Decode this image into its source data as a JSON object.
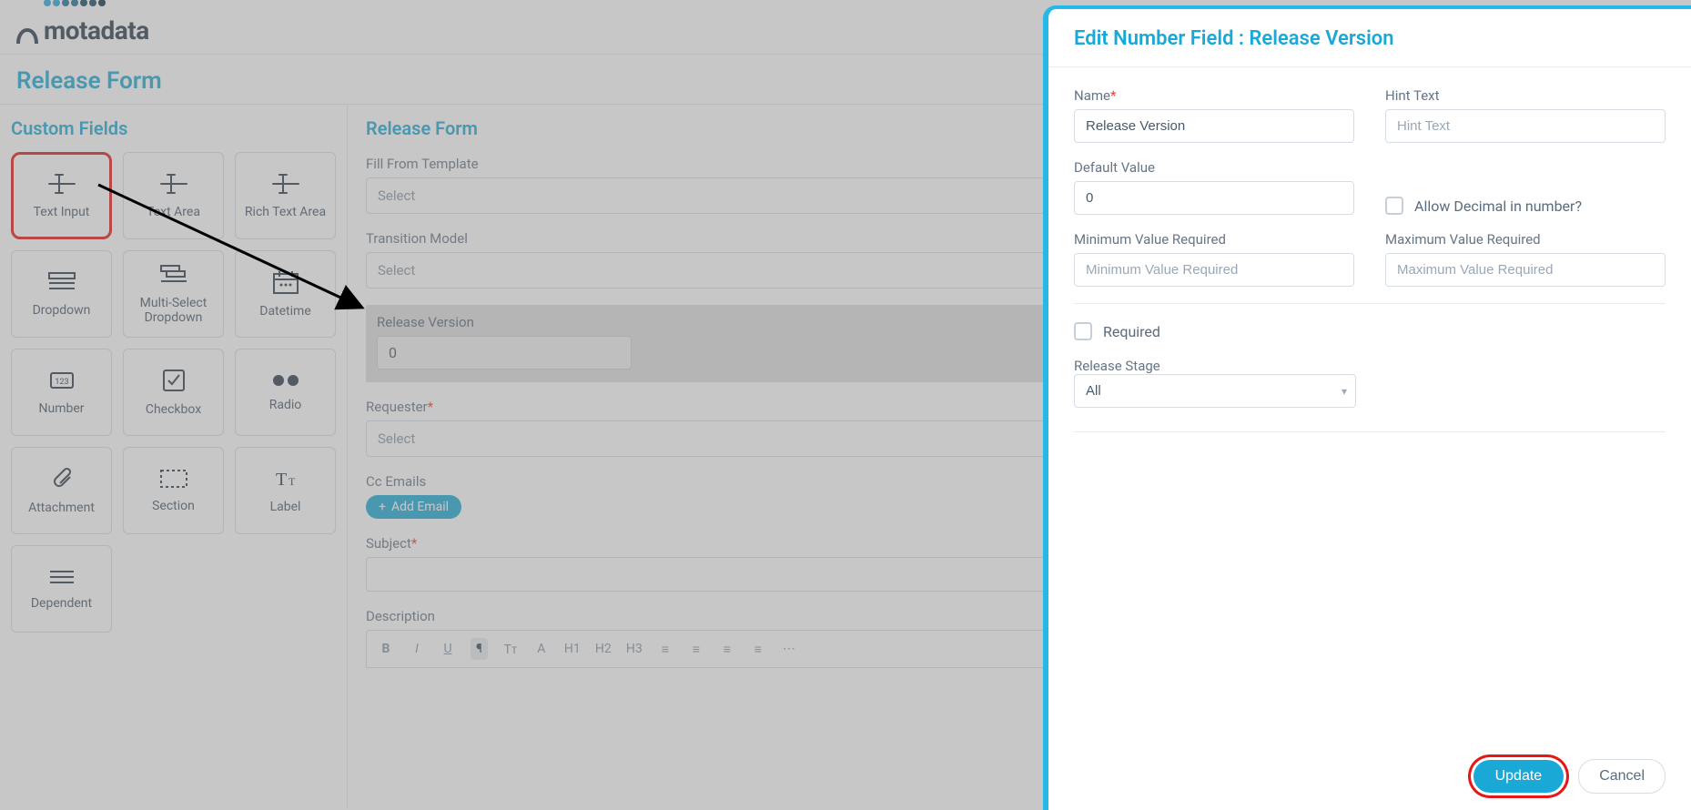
{
  "logo_text": "motadata",
  "page_title": "Release Form",
  "custom_fields": {
    "heading": "Custom Fields",
    "items": [
      {
        "label": "Text Input"
      },
      {
        "label": "Text Area"
      },
      {
        "label": "Rich Text Area"
      },
      {
        "label": "Dropdown"
      },
      {
        "label": "Multi-Select Dropdown"
      },
      {
        "label": "Datetime"
      },
      {
        "label": "Number"
      },
      {
        "label": "Checkbox"
      },
      {
        "label": "Radio"
      },
      {
        "label": "Attachment"
      },
      {
        "label": "Section"
      },
      {
        "label": "Label"
      },
      {
        "label": "Dependent"
      }
    ]
  },
  "form": {
    "heading": "Release Form",
    "fill_from_template": {
      "label": "Fill From Template",
      "placeholder": "Select"
    },
    "transition_model": {
      "label": "Transition Model",
      "placeholder": "Select"
    },
    "release_version": {
      "label": "Release Version",
      "value": "0"
    },
    "requester": {
      "label": "Requester",
      "placeholder": "Select"
    },
    "cc_emails": {
      "label": "Cc Emails",
      "add_label": "Add Email"
    },
    "subject": {
      "label": "Subject"
    },
    "description": {
      "label": "Description"
    },
    "rte_buttons": [
      "B",
      "I",
      "U",
      "¶",
      "Tᴛ",
      "A",
      "H1",
      "H2",
      "H3",
      "≡",
      "≡",
      "≡",
      "≡",
      "⋯"
    ]
  },
  "modal": {
    "title": "Edit Number Field : Release Version",
    "name_label": "Name",
    "name_value": "Release Version",
    "hint_label": "Hint Text",
    "hint_placeholder": "Hint Text",
    "default_label": "Default Value",
    "default_value": "0",
    "allow_decimal_label": "Allow Decimal in number?",
    "min_label": "Minimum Value Required",
    "min_placeholder": "Minimum Value Required",
    "max_label": "Maximum Value Required",
    "max_placeholder": "Maximum Value Required",
    "required_label": "Required",
    "stage_label": "Release Stage",
    "stage_value": "All",
    "update": "Update",
    "cancel": "Cancel"
  }
}
